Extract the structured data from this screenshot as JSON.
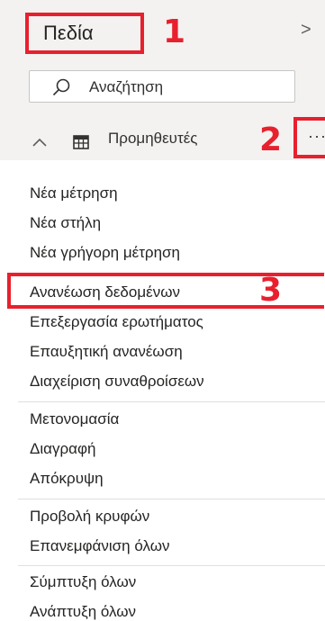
{
  "pane": {
    "title": "Πεδία",
    "collapse_glyph": ">",
    "search_placeholder": "Αναζήτηση",
    "table_name": "Προμηθευτές",
    "more_glyph": "···"
  },
  "callouts": [
    "1",
    "2",
    "3"
  ],
  "menu": {
    "group1": [
      "Νέα μέτρηση",
      "Νέα στήλη",
      "Νέα γρήγορη μέτρηση"
    ],
    "group2": [
      "Ανανέωση δεδομένων",
      "Επεξεργασία ερωτήματος",
      "Επαυξητική ανανέωση",
      "Διαχείριση συναθροίσεων"
    ],
    "group3": [
      "Μετονομασία",
      "Διαγραφή",
      "Απόκρυψη"
    ],
    "group4": [
      "Προβολή κρυφών",
      "Επανεμφάνιση όλων"
    ],
    "group5": [
      "Σύμπτυξη όλων",
      "Ανάπτυξη όλων"
    ]
  },
  "colors": {
    "highlight": "#e8202e",
    "pane_bg": "#f3f2f1"
  }
}
